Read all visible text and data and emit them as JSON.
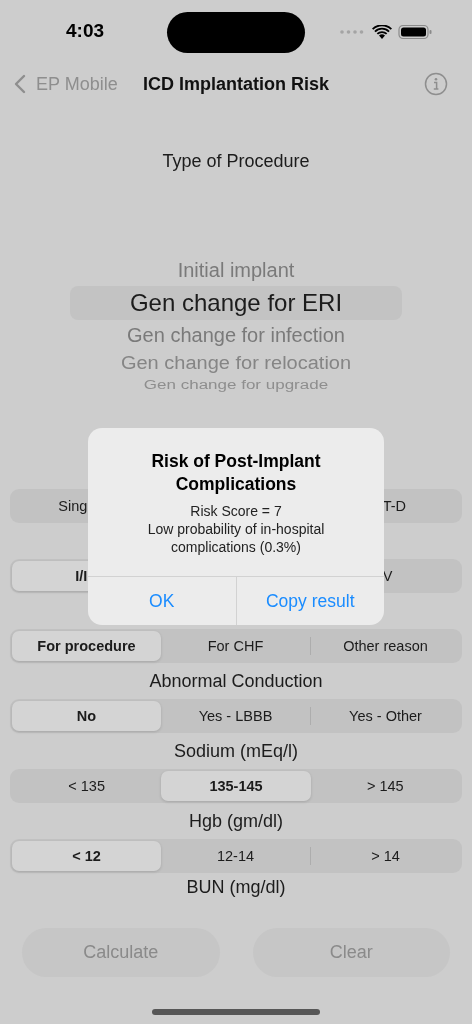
{
  "status_bar": {
    "time": "4:03"
  },
  "nav": {
    "back": "EP Mobile",
    "title": "ICD Implantation Risk"
  },
  "procedure": {
    "label": "Type of Procedure",
    "options": [
      {
        "label": "Initial implant",
        "selected": false
      },
      {
        "label": "Gen change for ERI",
        "selected": true
      },
      {
        "label": "Gen change for infection",
        "selected": false
      },
      {
        "label": "Gen change for relocation",
        "selected": false
      },
      {
        "label": "Gen change for upgrade",
        "selected": false
      }
    ]
  },
  "sections": [
    {
      "options": [
        {
          "label": "Sing",
          "selected": false
        },
        {
          "label": "T-D",
          "selected": false
        }
      ]
    },
    {
      "options": [
        {
          "label": "I/I",
          "selected": true
        },
        {
          "label": "V",
          "selected": false
        }
      ]
    },
    {
      "options": [
        {
          "label": "For procedure",
          "selected": true
        },
        {
          "label": "For CHF",
          "selected": false
        },
        {
          "label": "Other reason",
          "selected": false
        }
      ]
    },
    {
      "label": "Abnormal Conduction",
      "options": [
        {
          "label": "No",
          "selected": true
        },
        {
          "label": "Yes - LBBB",
          "selected": false
        },
        {
          "label": "Yes - Other",
          "selected": false
        }
      ]
    },
    {
      "label": "Sodium (mEq/l)",
      "options": [
        {
          "label": "< 135",
          "selected": false
        },
        {
          "label": "135-145",
          "selected": true
        },
        {
          "label": "> 145",
          "selected": false
        }
      ]
    },
    {
      "label": "Hgb (gm/dl)",
      "options": [
        {
          "label": "< 12",
          "selected": true
        },
        {
          "label": "12-14",
          "selected": false
        },
        {
          "label": "> 14",
          "selected": false
        }
      ]
    },
    {
      "label": "BUN (mg/dl)"
    }
  ],
  "buttons": [
    {
      "label": "Calculate",
      "disabled": true
    },
    {
      "label": "Clear",
      "disabled": true
    }
  ],
  "alert": {
    "title": "Risk of Post-Implant Complications",
    "message": [
      "Risk Score = 7",
      "Low probability of in-hospital complications (0.3%)"
    ],
    "actions": [
      "OK",
      "Copy result"
    ]
  }
}
